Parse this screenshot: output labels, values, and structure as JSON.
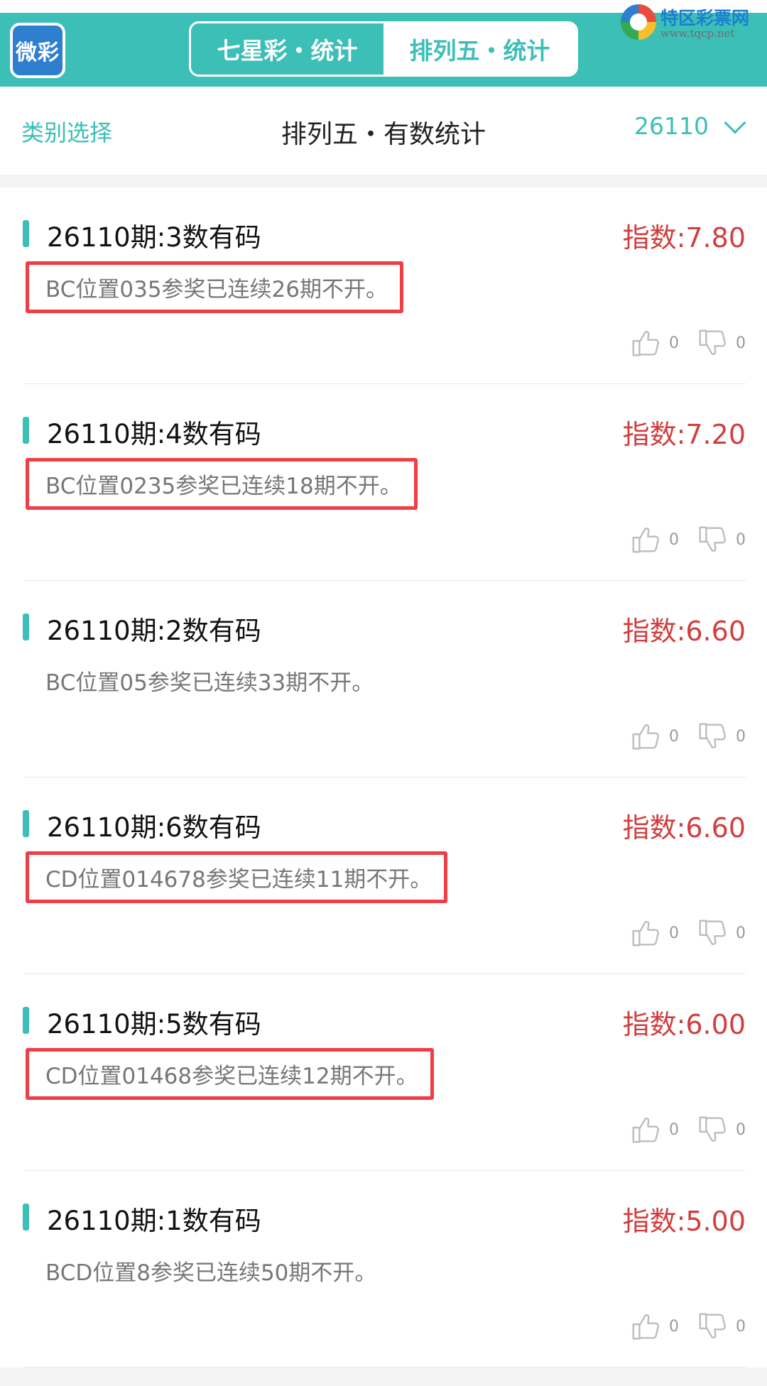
{
  "header": {
    "logo_text": "微彩",
    "tabs": [
      {
        "label": "七星彩・统计",
        "active": false
      },
      {
        "label": "排列五・统计",
        "active": true
      }
    ],
    "watermark": {
      "title": "特区彩票网",
      "url": "www.tqcp.net"
    }
  },
  "subbar": {
    "category_label": "类别选择",
    "title": "排列五・有数统计",
    "issue": "26110"
  },
  "colors": {
    "accent": "#3bbfb6",
    "index_red": "#d13e3e",
    "highlight_box": "#ef3e46"
  },
  "icons": {
    "like": "thumbs-up-icon",
    "dislike": "thumbs-down-icon",
    "dropdown": "chevron-down-icon"
  },
  "records": [
    {
      "title": "26110期:3数有码",
      "index": "指数:7.80",
      "desc": "BC位置035参奖已连续26期不开。",
      "highlighted": true,
      "likes": "0",
      "dislikes": "0"
    },
    {
      "title": "26110期:4数有码",
      "index": "指数:7.20",
      "desc": "BC位置0235参奖已连续18期不开。",
      "highlighted": true,
      "likes": "0",
      "dislikes": "0"
    },
    {
      "title": "26110期:2数有码",
      "index": "指数:6.60",
      "desc": "BC位置05参奖已连续33期不开。",
      "highlighted": false,
      "likes": "0",
      "dislikes": "0"
    },
    {
      "title": "26110期:6数有码",
      "index": "指数:6.60",
      "desc": "CD位置014678参奖已连续11期不开。",
      "highlighted": true,
      "likes": "0",
      "dislikes": "0"
    },
    {
      "title": "26110期:5数有码",
      "index": "指数:6.00",
      "desc": "CD位置01468参奖已连续12期不开。",
      "highlighted": true,
      "likes": "0",
      "dislikes": "0"
    },
    {
      "title": "26110期:1数有码",
      "index": "指数:5.00",
      "desc": "BCD位置8参奖已连续50期不开。",
      "highlighted": false,
      "likes": "0",
      "dislikes": "0"
    }
  ]
}
